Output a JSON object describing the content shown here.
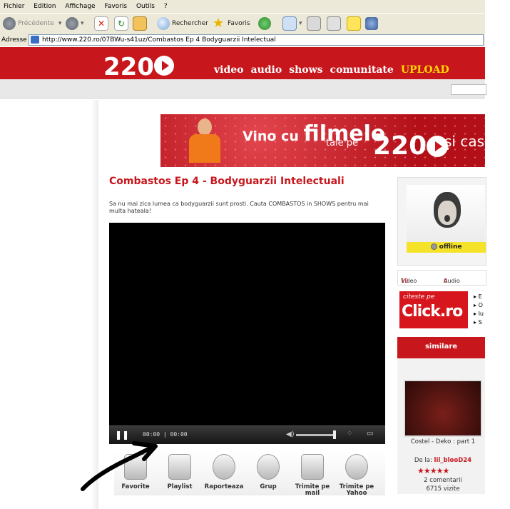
{
  "browser": {
    "menu": [
      "Fichier",
      "Edition",
      "Affichage",
      "Favoris",
      "Outils",
      "?"
    ],
    "toolbar": {
      "back": "Précédente",
      "search": "Rechercher",
      "favorites": "Favoris"
    },
    "address_label": "Adresse",
    "url": "http://www.220.ro/07BWu-s41uz/Combastos Ep 4 Bodyguarzii Intelectual"
  },
  "site": {
    "logo": "220",
    "nav": [
      "video",
      "audio",
      "shows",
      "comunitate",
      "UPLOAD"
    ],
    "banner": {
      "line1_prefix": "Vino cu",
      "line1_big": "filmele",
      "line2": "tale pe",
      "logo": "220",
      "suffix": "și cas"
    }
  },
  "video": {
    "title": "Combastos Ep 4 - Bodyguarzii Intelectuali",
    "description": "Sa nu mai zica lumea ca bodyguarzii sunt prosti. Cauta COMBASTOS in SHOWS pentru mai multa hateala!",
    "player": {
      "play_symbol": "❚❚",
      "time": "00:00 | 00:00"
    },
    "actions": [
      {
        "label": "Favorite",
        "icon": "star-icon"
      },
      {
        "label": "Playlist",
        "icon": "playlist-icon"
      },
      {
        "label": "Raporteaza",
        "icon": "report-icon"
      },
      {
        "label": "Grup",
        "icon": "group-icon"
      },
      {
        "label": "Trimite pe mail",
        "icon": "mail-icon"
      },
      {
        "label": "Trimite pe Yahoo",
        "icon": "yahoo-icon"
      }
    ]
  },
  "sidebar": {
    "status": "offline",
    "stats": {
      "videos_label": "Video",
      "videos_count": "10",
      "audio_label": "Audio",
      "audio_count": "0"
    },
    "ad": {
      "line1": "citeste pe",
      "line2": "Click.ro"
    },
    "ad_links": [
      "E",
      "O",
      "Iu",
      "S"
    ],
    "similar_header": "similare",
    "similar_item": {
      "title": "Costel - Deko : part 1",
      "by_label": "De la:",
      "by_user": "lil_blooD24",
      "stars": "★★★★★",
      "comments": "2 comentarii",
      "views": "6715 vizite"
    }
  },
  "colors": {
    "brand_red": "#c8161d",
    "upload_yellow": "#ffd800",
    "offline_yellow": "#f5e32a"
  }
}
